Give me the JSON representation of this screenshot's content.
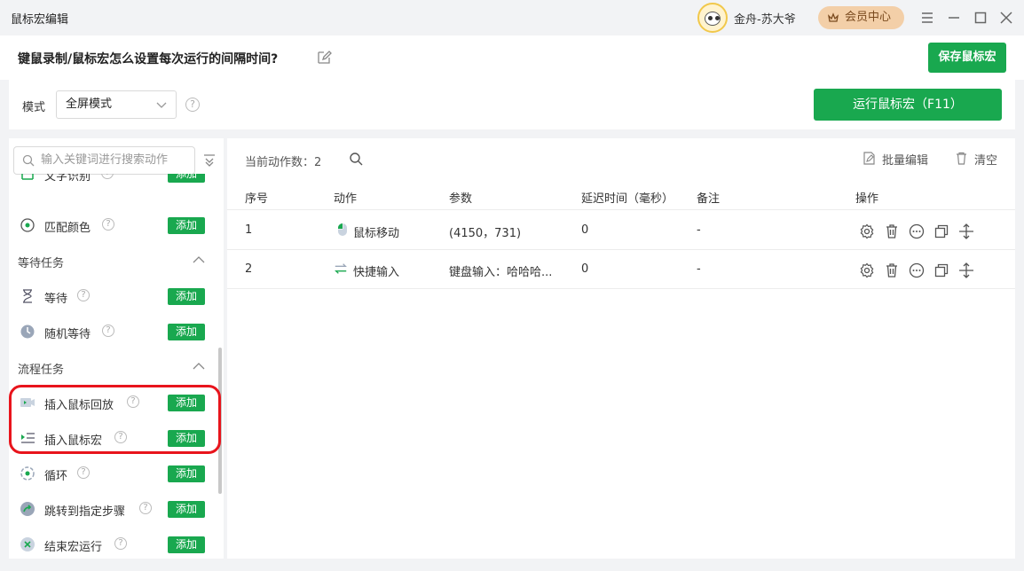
{
  "titlebar": {
    "app_title": "鼠标宏编辑",
    "user_name": "金舟-苏大爷",
    "vip_label": "会员中心"
  },
  "header": {
    "question": "键鼠录制/鼠标宏怎么设置每次运行的间隔时间?",
    "save_label": "保存鼠标宏"
  },
  "modebar": {
    "mode_label": "模式",
    "mode_value": "全屏模式",
    "run_label": "运行鼠标宏（F11）"
  },
  "sidebar": {
    "search_placeholder": "输入关键词进行搜索动作",
    "add_label": "添加",
    "items": [
      {
        "label": "文字识别",
        "icon": "text-recognition-icon"
      },
      {
        "label": "匹配颜色",
        "icon": "color-match-icon"
      },
      {
        "label": "等待",
        "icon": "hourglass-icon"
      },
      {
        "label": "随机等待",
        "icon": "clock-icon"
      },
      {
        "label": "插入鼠标回放",
        "icon": "video-icon"
      },
      {
        "label": "插入鼠标宏",
        "icon": "list-play-icon"
      },
      {
        "label": "循环",
        "icon": "loop-icon"
      },
      {
        "label": "跳转到指定步骤",
        "icon": "jump-icon"
      },
      {
        "label": "结束宏运行",
        "icon": "stop-icon"
      }
    ],
    "sections": [
      {
        "title": "等待任务"
      },
      {
        "title": "流程任务"
      }
    ]
  },
  "main": {
    "count_text": "当前动作数：2",
    "batch_edit": "批量编辑",
    "clear": "清空",
    "columns": [
      "序号",
      "动作",
      "参数",
      "延迟时间（毫秒）",
      "备注",
      "操作"
    ],
    "rows": [
      {
        "index": "1",
        "action": "鼠标移动",
        "param": "(4150，731)",
        "delay": "0",
        "note": "-"
      },
      {
        "index": "2",
        "action": "快捷输入",
        "param": "键盘输入：哈哈哈...",
        "delay": "0",
        "note": "-"
      }
    ]
  },
  "colors": {
    "accent": "#19a84f",
    "highlight": "#e8141c",
    "vip": "#f3cfa8"
  }
}
